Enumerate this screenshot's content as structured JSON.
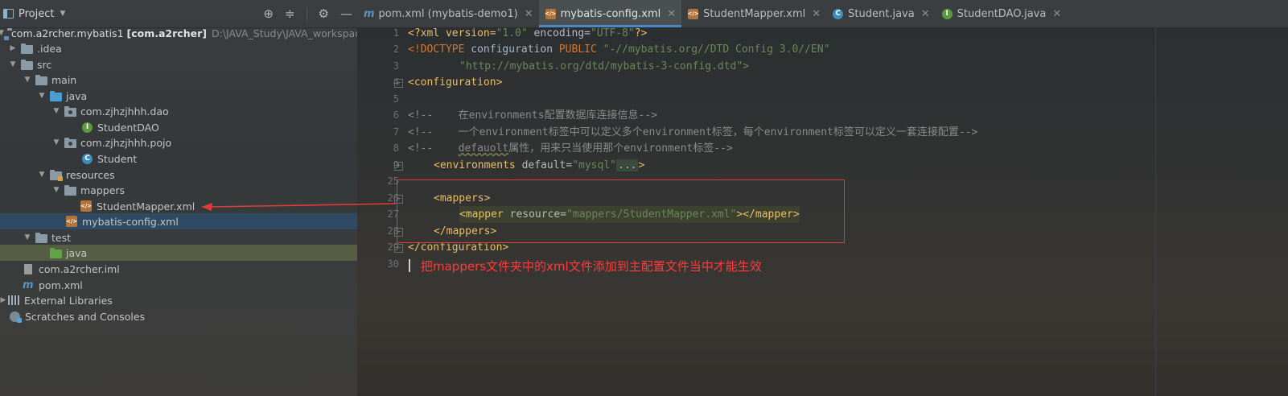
{
  "project_panel": {
    "title": "Project",
    "tree": [
      {
        "label": "com.a2rcher.mybatis1",
        "module": "[com.a2rcher]",
        "path": "D:\\JAVA_Study\\JAVA_workspace\\c"
      },
      {
        "label": ".idea"
      },
      {
        "label": "src"
      },
      {
        "label": "main"
      },
      {
        "label": "java"
      },
      {
        "label": "com.zjhzjhhh.dao"
      },
      {
        "label": "StudentDAO"
      },
      {
        "label": "com.zjhzjhhh.pojo"
      },
      {
        "label": "Student"
      },
      {
        "label": "resources"
      },
      {
        "label": "mappers"
      },
      {
        "label": "StudentMapper.xml"
      },
      {
        "label": "mybatis-config.xml"
      },
      {
        "label": "test"
      },
      {
        "label": "java"
      },
      {
        "label": "com.a2rcher.iml"
      },
      {
        "label": "pom.xml"
      },
      {
        "label": "External Libraries"
      },
      {
        "label": "Scratches and Consoles"
      }
    ]
  },
  "tabs": [
    {
      "label": "pom.xml (mybatis-demo1)"
    },
    {
      "label": "mybatis-config.xml"
    },
    {
      "label": "StudentMapper.xml"
    },
    {
      "label": "Student.java"
    },
    {
      "label": "StudentDAO.java"
    }
  ],
  "editor": {
    "line_numbers": [
      "1",
      "2",
      "3",
      "4",
      "5",
      "6",
      "7",
      "8",
      "9",
      "25",
      "26",
      "27",
      "28",
      "29",
      "30"
    ],
    "code": {
      "l1": [
        "<?xml version=",
        "\"1.0\"",
        " encoding=",
        "\"UTF-8\"",
        "?>"
      ],
      "l2": [
        "<!DOCTYPE ",
        "configuration ",
        "PUBLIC ",
        "\"-//mybatis.org//DTD Config 3.0//EN\""
      ],
      "l3": "\"http://mybatis.org/dtd/mybatis-3-config.dtd\">",
      "l4": "<configuration>",
      "l6": "<!--    在environments配置数据库连接信息-->",
      "l7": "<!--    一个environment标签中可以定义多个environment标签，每个environment标签可以定义一套连接配置-->",
      "l8a": "<!--    ",
      "l8b": "defauolt",
      "l8c": "属性，用来只当使用那个environment标签-->",
      "l9": [
        "<environments ",
        "default=",
        "\"mysql\"",
        "...",
        ">"
      ],
      "l26": "<mappers>",
      "l27": [
        "<mapper ",
        "resource=",
        "\"mappers/StudentMapper.xml\"",
        "></mapper>"
      ],
      "l28": "</mappers>",
      "l29": "</configuration>"
    },
    "annotation": "把mappers文件夹中的xml文件添加到主配置文件当中才能生效"
  }
}
